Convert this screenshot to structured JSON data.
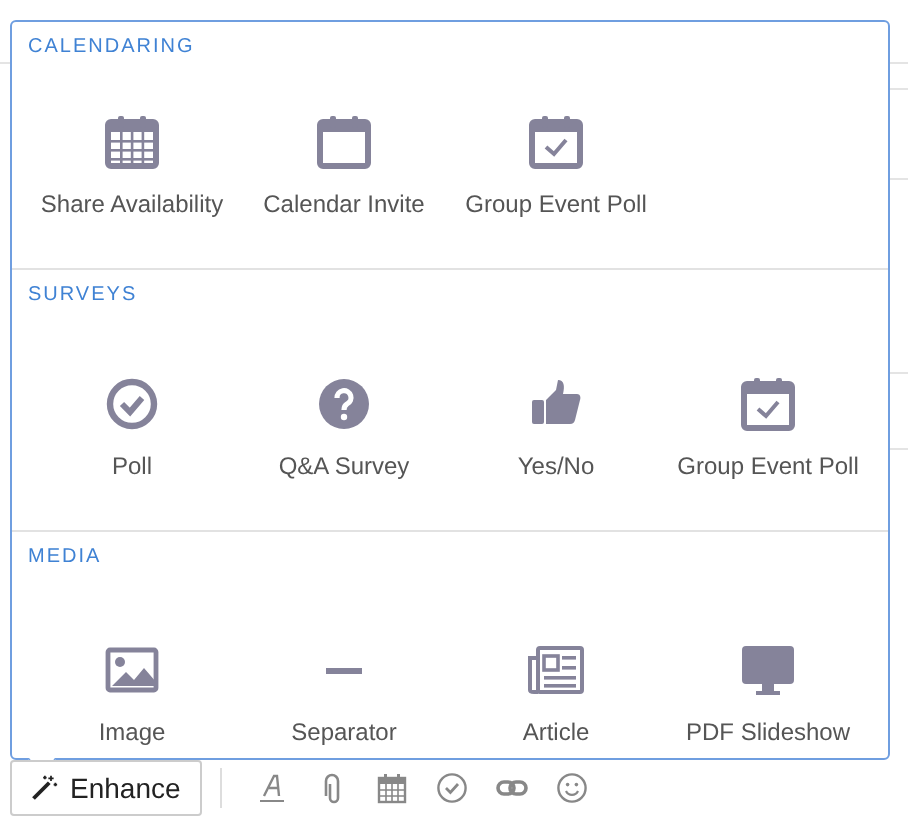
{
  "sections": [
    {
      "title": "CALENDARING",
      "items": [
        "Share Availability",
        "Calendar Invite",
        "Group Event Poll"
      ]
    },
    {
      "title": "SURVEYS",
      "items": [
        "Poll",
        "Q&A Survey",
        "Yes/No",
        "Group Event Poll"
      ]
    },
    {
      "title": "MEDIA",
      "items": [
        "Image",
        "Separator",
        "Article",
        "PDF Slideshow"
      ]
    }
  ],
  "toolbar": {
    "enhance_button": "Enhance"
  }
}
